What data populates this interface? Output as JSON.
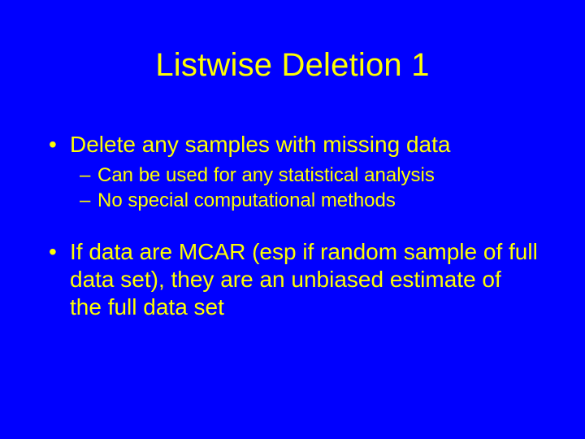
{
  "slide": {
    "title": "Listwise Deletion 1",
    "bullets": [
      {
        "text": "Delete any samples with missing data",
        "sub": [
          {
            "text": "Can be used for any statistical analysis"
          },
          {
            "text": "No special computational methods"
          }
        ]
      },
      {
        "text": "If data are MCAR (esp if random sample of full data set), they are an unbiased estimate of the full data set",
        "sub": []
      }
    ],
    "glyphs": {
      "dot": "•",
      "dash": "–"
    }
  }
}
